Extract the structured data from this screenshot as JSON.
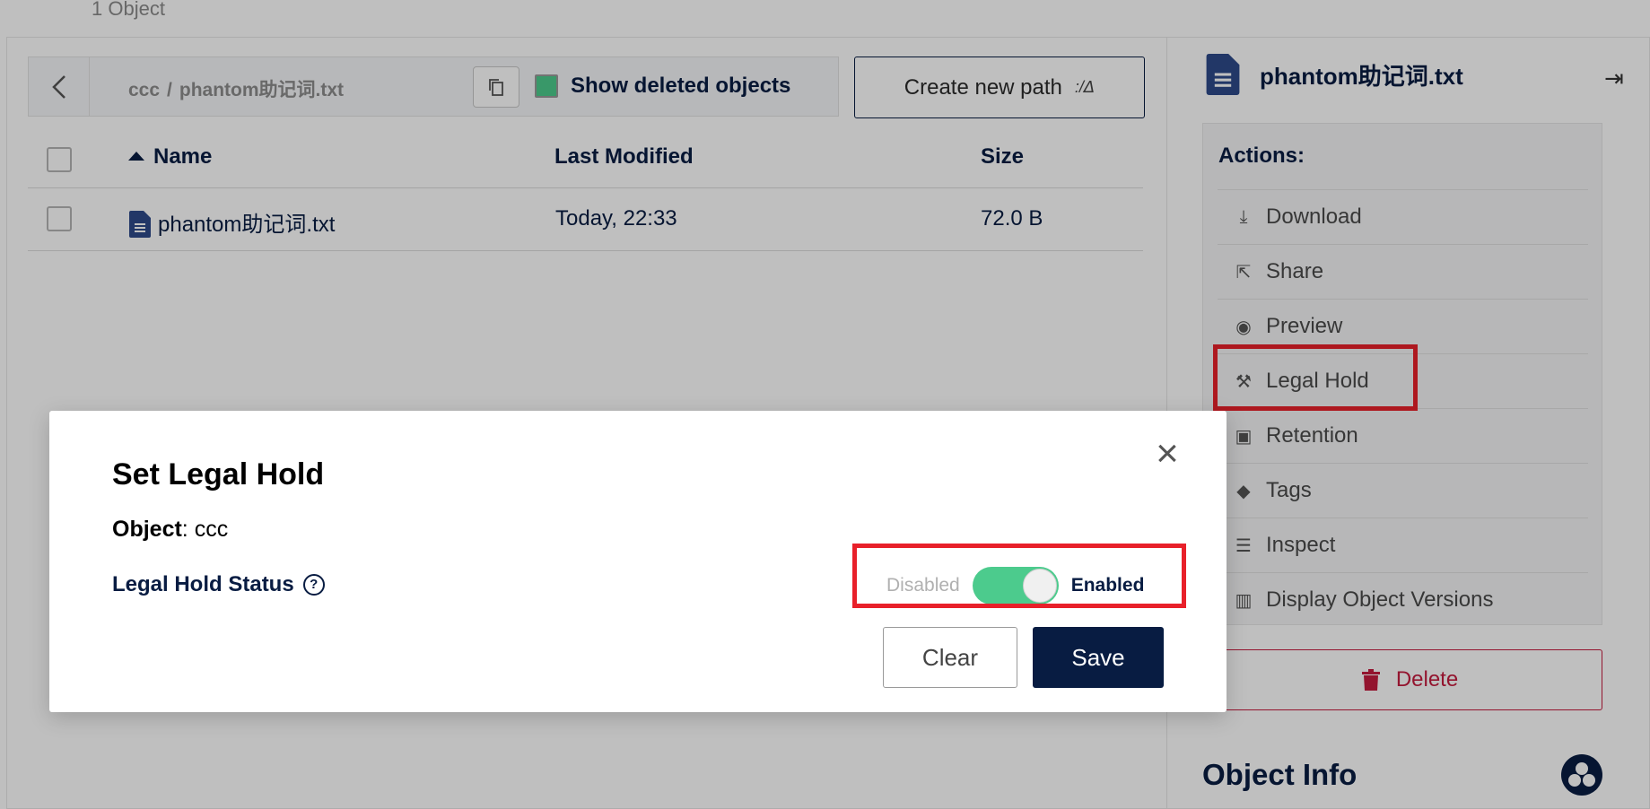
{
  "browser": {
    "object_count": "1 Object"
  },
  "breadcrumb": {
    "bucket": "ccc",
    "separator": "/",
    "file": "phantom助记词.txt"
  },
  "show_deleted": {
    "label": "Show deleted objects",
    "checked": true
  },
  "create_path": {
    "label": "Create new path"
  },
  "table": {
    "columns": [
      "Name",
      "Last Modified",
      "Size"
    ],
    "rows": [
      {
        "name": "phantom助记词.txt",
        "modified": "Today, 22:33",
        "size": "72.0 B"
      }
    ]
  },
  "panel": {
    "title": "phantom助记词.txt",
    "actions_title": "Actions:",
    "actions": [
      {
        "label": "Download",
        "icon": "download-icon"
      },
      {
        "label": "Share",
        "icon": "share-icon"
      },
      {
        "label": "Preview",
        "icon": "eye-icon"
      },
      {
        "label": "Legal Hold",
        "icon": "gavel-icon"
      },
      {
        "label": "Retention",
        "icon": "calendar-icon"
      },
      {
        "label": "Tags",
        "icon": "tag-icon"
      },
      {
        "label": "Inspect",
        "icon": "inspect-icon"
      },
      {
        "label": "Display Object Versions",
        "icon": "versions-icon"
      }
    ],
    "delete_label": "Delete",
    "object_info": "Object Info"
  },
  "modal": {
    "title": "Set Legal Hold",
    "object_label": "Object",
    "object_value": "ccc",
    "status_label": "Legal Hold Status",
    "toggle_off": "Disabled",
    "toggle_on": "Enabled",
    "enabled": true,
    "clear_label": "Clear",
    "save_label": "Save"
  },
  "colors": {
    "accent": "#081c42",
    "toggle_on": "#4ccb8d",
    "danger": "#c51b3e",
    "highlight": "#e8202a"
  }
}
